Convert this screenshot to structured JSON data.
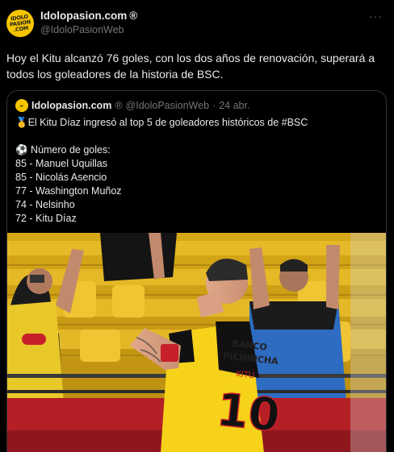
{
  "author": {
    "display_name": "Idolopasion.com",
    "verified_mark": "®",
    "handle": "@IdoloPasionWeb",
    "avatar_text": "IDOLO PASION .COM"
  },
  "more_icon": "···",
  "tweet_text": "Hoy el Kitu alcanzó 76 goles, con los dos años de renovación, superará a todos los goleadores de la historia de BSC.",
  "quote": {
    "display_name": "Idolopasion.com",
    "verified_mark": "®",
    "handle": "@IdoloPasionWeb",
    "separator": "·",
    "date": "24 abr.",
    "lines": [
      "🥇El Kitu Díaz ingresó al top 5 de goleadores históricos de #BSC",
      "",
      "⚽ Número de goles:",
      "85 - Manuel Uquillas",
      "85 - Nicolás Asencio",
      "77 - Washington Muñoz",
      "74 - Nelsinho",
      "72 - Kitu Díaz"
    ]
  },
  "photo": {
    "jersey_sponsor": "BANCO PICHINCHA",
    "jersey_name": "KITU",
    "jersey_number": "10"
  },
  "colors": {
    "background": "#000000",
    "text": "#e7e9ea",
    "muted": "#71767b",
    "border": "#2f3336",
    "brand_yellow": "#f6c500"
  }
}
